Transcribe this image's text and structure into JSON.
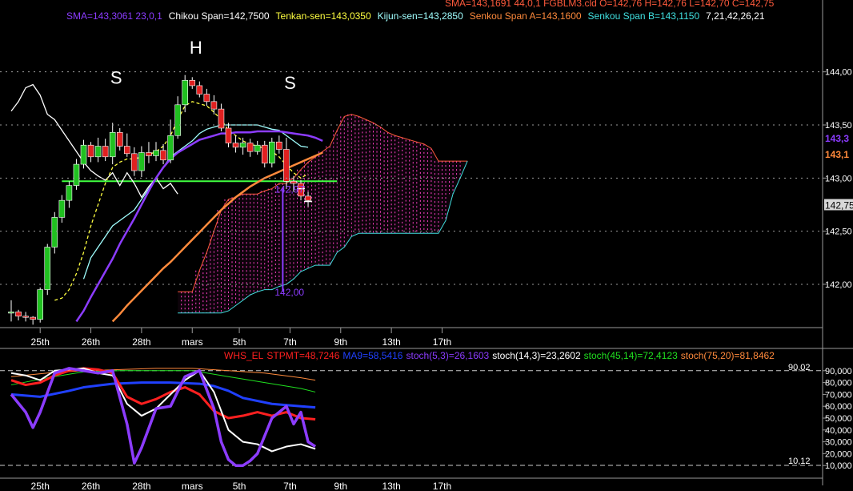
{
  "header": {
    "top_line": "SMA=143,1691  44,0,1      FGBLM3.cld O=142,76 H=142,76 L=142,70 C=142,75",
    "legend": [
      {
        "text": "SMA=143,3061  23,0,1",
        "color": "#8c3cff"
      },
      {
        "text": "Chikou Span=142,7500",
        "color": "#ffffff"
      },
      {
        "text": "Tenkan-sen=143,0350",
        "color": "#ffff40"
      },
      {
        "text": "Kijun-sen=143,2850",
        "color": "#a0ffff"
      },
      {
        "text": "Senkou Span A=143,1600",
        "color": "#ff8a3c"
      },
      {
        "text": "Senkou Span B=143,1150",
        "color": "#40e0e0"
      },
      {
        "text": "7,21,42,26,21",
        "color": "#ffffff"
      }
    ]
  },
  "pattern_labels": [
    {
      "text": "S",
      "bar": 14.5,
      "price": 143.89
    },
    {
      "text": "H",
      "bar": 25.5,
      "price": 144.17
    },
    {
      "text": "S",
      "bar": 38.5,
      "price": 143.84
    }
  ],
  "price_axis": {
    "ticks": [
      "144,00",
      "143,50",
      "143,00",
      "142,50",
      "142,00"
    ],
    "tick_values": [
      144.0,
      143.5,
      143.0,
      142.5,
      142.0
    ],
    "tags": [
      {
        "text": "143,3",
        "value": 143.38,
        "color": "#8c3cff"
      },
      {
        "text": "143,1",
        "value": 143.23,
        "color": "#ff8a3c"
      },
      {
        "text": "142,75",
        "value": 142.75,
        "color": "#000000",
        "bg": "#d8d8d8"
      }
    ]
  },
  "annotations": [
    {
      "text": "142,97",
      "bar": 37.5,
      "price": 142.9,
      "color": "#8c3cff"
    },
    {
      "text": "142,00",
      "bar": 37.5,
      "price": 141.93,
      "color": "#8c3cff"
    }
  ],
  "x_axis": {
    "labels": [
      {
        "text": "25th",
        "bar": 4
      },
      {
        "text": "26th",
        "bar": 11
      },
      {
        "text": "28th",
        "bar": 18
      },
      {
        "text": "mars",
        "bar": 25
      },
      {
        "text": "5th",
        "bar": 31.5
      },
      {
        "text": "7th",
        "bar": 38.5
      },
      {
        "text": "9th",
        "bar": 45.5
      },
      {
        "text": "13th",
        "bar": 52.5
      },
      {
        "text": "17th",
        "bar": 59.5
      }
    ]
  },
  "indicator": {
    "legend": [
      {
        "text": "WHS_EL",
        "color": "#ff2020"
      },
      {
        "text": "STPMT=48,7246",
        "color": "#ff2020"
      },
      {
        "text": "MA9=58,5416",
        "color": "#2040ff"
      },
      {
        "text": "stoch(5,3)=26,1603",
        "color": "#8c3cff"
      },
      {
        "text": "stoch(14,3)=23,2602",
        "color": "#ffffff"
      },
      {
        "text": "stoch(45,14)=72,4123",
        "color": "#20e020"
      },
      {
        "text": "stoch(75,20)=81,8462",
        "color": "#ff8a3c"
      }
    ],
    "ticks": [
      "90,000",
      "80,000",
      "70,000",
      "60,000",
      "50,000",
      "40,000",
      "30,000",
      "20,000",
      "10,000"
    ],
    "tick_values": [
      90,
      80,
      70,
      60,
      50,
      40,
      30,
      20,
      10
    ],
    "level_high": "90,02",
    "level_low": "10,12"
  },
  "chart_data": {
    "type": "line",
    "title": "FGBLM3.cld",
    "ylim": [
      141.6,
      144.45
    ],
    "candles": {
      "open": [
        141.73,
        141.74,
        141.7,
        141.69,
        141.67,
        141.95,
        142.35,
        142.63,
        142.79,
        142.93,
        143.13,
        143.31,
        143.2,
        143.3,
        143.2,
        143.43,
        143.3,
        143.23,
        143.07,
        143.24,
        143.21,
        143.26,
        143.17,
        143.4,
        143.69,
        143.92,
        143.87,
        143.79,
        143.72,
        143.65,
        143.47,
        143.33,
        143.29,
        143.33,
        143.25,
        143.31,
        143.14,
        143.34,
        143.27,
        142.97,
        142.95,
        142.83
      ],
      "close": [
        141.74,
        141.7,
        141.69,
        141.67,
        141.95,
        142.35,
        142.63,
        142.79,
        142.93,
        143.13,
        143.31,
        143.2,
        143.3,
        143.2,
        143.43,
        143.3,
        143.23,
        143.07,
        143.24,
        143.21,
        143.26,
        143.17,
        143.4,
        143.69,
        143.92,
        143.87,
        143.79,
        143.72,
        143.65,
        143.47,
        143.33,
        143.29,
        143.33,
        143.25,
        143.31,
        143.14,
        143.34,
        143.27,
        142.97,
        142.95,
        142.83,
        142.79
      ],
      "high": [
        141.85,
        141.76,
        141.74,
        141.7,
        141.97,
        142.38,
        142.68,
        142.84,
        142.97,
        143.18,
        143.36,
        143.34,
        143.38,
        143.37,
        143.52,
        143.47,
        143.42,
        143.29,
        143.3,
        143.34,
        143.34,
        143.32,
        143.55,
        143.77,
        143.97,
        143.95,
        143.91,
        143.84,
        143.78,
        143.7,
        143.52,
        143.4,
        143.38,
        143.37,
        143.35,
        143.35,
        143.38,
        143.4,
        143.38,
        143.02,
        142.98,
        142.87
      ],
      "low": [
        141.65,
        141.66,
        141.65,
        141.62,
        141.64,
        141.9,
        142.29,
        142.58,
        142.72,
        142.89,
        143.09,
        143.15,
        143.15,
        143.16,
        143.13,
        143.26,
        143.2,
        143.02,
        143.01,
        143.14,
        143.16,
        143.13,
        143.14,
        143.37,
        143.62,
        143.84,
        143.76,
        143.68,
        143.6,
        143.44,
        143.29,
        143.24,
        143.22,
        143.2,
        143.22,
        143.1,
        143.1,
        143.23,
        142.9,
        142.87,
        142.79,
        142.73
      ]
    },
    "series": [
      {
        "name": "Chikou Span",
        "color": "#ffffff",
        "x": [
          0,
          1,
          2,
          3,
          4,
          5,
          6,
          7,
          8,
          9,
          10,
          11,
          12,
          13,
          14,
          15,
          16,
          17,
          18,
          19,
          20,
          21,
          22,
          23
        ],
        "values": [
          143.63,
          143.72,
          143.85,
          143.88,
          143.78,
          143.6,
          143.55,
          143.45,
          143.35,
          143.25,
          143.15,
          143.07,
          143.02,
          142.98,
          143.05,
          142.93,
          143.05,
          142.95,
          142.82,
          142.92,
          143.0,
          142.9,
          142.95,
          142.85
        ]
      },
      {
        "name": "Tenkan-sen",
        "color": "#ffff40",
        "x": [
          6,
          7,
          8,
          9,
          10,
          11,
          12,
          13,
          14,
          15,
          16,
          17,
          18,
          19,
          20,
          21,
          22,
          23,
          24,
          25,
          26,
          27,
          28,
          29,
          30,
          31,
          32,
          33,
          34,
          35,
          36,
          37,
          38,
          39,
          40,
          41
        ],
        "values": [
          141.85,
          141.87,
          141.95,
          142.1,
          142.3,
          142.55,
          142.75,
          142.95,
          143.1,
          143.15,
          143.18,
          143.18,
          143.2,
          143.22,
          143.25,
          143.3,
          143.4,
          143.55,
          143.68,
          143.72,
          143.7,
          143.68,
          143.62,
          143.55,
          143.45,
          143.4,
          143.35,
          143.32,
          143.3,
          143.28,
          143.25,
          143.2,
          143.12,
          143.05,
          143.0,
          143.04
        ]
      },
      {
        "name": "Kijun-sen",
        "color": "#a0ffff",
        "x": [
          10,
          11,
          12,
          13,
          14,
          15,
          16,
          17,
          18,
          19,
          20,
          21,
          22,
          23,
          24,
          25,
          26,
          27,
          28,
          29,
          30,
          31,
          32,
          33,
          34,
          35,
          36,
          37,
          38,
          39,
          40,
          41
        ],
        "values": [
          142.05,
          142.25,
          142.35,
          142.45,
          142.55,
          142.6,
          142.65,
          142.7,
          142.8,
          142.9,
          143.0,
          143.1,
          143.2,
          143.25,
          143.3,
          143.35,
          143.42,
          143.46,
          143.48,
          143.5,
          143.5,
          143.5,
          143.5,
          143.5,
          143.5,
          143.48,
          143.46,
          143.45,
          143.4,
          143.35,
          143.3,
          143.29
        ]
      },
      {
        "name": "SMA 23",
        "color": "#8c3cff",
        "x": [
          9,
          10,
          11,
          12,
          13,
          14,
          15,
          16,
          17,
          18,
          19,
          20,
          21,
          22,
          23,
          24,
          25,
          26,
          27,
          28,
          29,
          30,
          31,
          32,
          33,
          34,
          35,
          36,
          37,
          38,
          39,
          40,
          41,
          42,
          43
        ],
        "values": [
          141.65,
          141.75,
          141.88,
          142.0,
          142.12,
          142.24,
          142.38,
          142.5,
          142.62,
          142.75,
          142.88,
          143.0,
          143.1,
          143.18,
          143.24,
          143.28,
          143.32,
          143.36,
          143.38,
          143.4,
          143.42,
          143.42,
          143.43,
          143.43,
          143.43,
          143.44,
          143.44,
          143.44,
          143.44,
          143.43,
          143.42,
          143.41,
          143.4,
          143.38,
          143.35
        ]
      },
      {
        "name": "SMA 44",
        "color": "#ff8a3c",
        "x": [
          14,
          15,
          16,
          17,
          18,
          19,
          20,
          21,
          22,
          23,
          24,
          25,
          26,
          27,
          28,
          29,
          30,
          31,
          32,
          33,
          34,
          35,
          36,
          37,
          38,
          39,
          40,
          41,
          42,
          43
        ],
        "values": [
          141.65,
          141.72,
          141.8,
          141.87,
          141.94,
          142.01,
          142.08,
          142.15,
          142.21,
          142.28,
          142.35,
          142.42,
          142.49,
          142.56,
          142.63,
          142.7,
          142.76,
          142.82,
          142.87,
          142.92,
          142.96,
          143.0,
          143.03,
          143.06,
          143.09,
          143.12,
          143.15,
          143.18,
          143.21,
          143.24
        ]
      }
    ],
    "cloud": {
      "x": [
        23,
        24,
        25,
        26,
        27,
        28,
        29,
        30,
        31,
        32,
        33,
        34,
        35,
        36,
        37,
        38,
        39,
        40,
        41,
        42,
        43,
        44,
        45,
        46,
        47,
        48,
        49,
        50,
        51,
        52,
        53,
        54,
        55,
        56,
        57,
        58,
        59,
        60,
        61,
        62,
        63
      ],
      "span_a": [
        141.93,
        141.93,
        141.93,
        142.13,
        142.3,
        142.5,
        142.7,
        142.8,
        142.82,
        142.85,
        142.85,
        142.85,
        142.88,
        142.9,
        142.95,
        142.95,
        143.0,
        143.08,
        143.15,
        143.2,
        143.25,
        143.3,
        143.45,
        143.58,
        143.6,
        143.58,
        143.55,
        143.52,
        143.48,
        143.43,
        143.4,
        143.38,
        143.36,
        143.34,
        143.32,
        143.28,
        143.16,
        143.16,
        143.16,
        143.16,
        143.16
      ],
      "span_b": [
        141.73,
        141.73,
        141.73,
        141.73,
        141.73,
        141.73,
        141.73,
        141.75,
        141.8,
        141.85,
        141.9,
        141.93,
        141.95,
        141.95,
        141.98,
        142.0,
        142.05,
        142.12,
        142.15,
        142.18,
        142.18,
        142.18,
        142.3,
        142.35,
        142.45,
        142.48,
        142.48,
        142.48,
        142.48,
        142.48,
        142.48,
        142.48,
        142.48,
        142.48,
        142.48,
        142.48,
        142.48,
        142.6,
        142.85,
        143.0,
        143.16
      ]
    },
    "horizontal_line": {
      "value": 142.97,
      "color": "#40ff40",
      "from_bar": 7,
      "to_bar": 45
    },
    "vertical_marker": {
      "bar": 37.5,
      "from": 141.93,
      "to": 142.9,
      "color": "#8c3cff"
    },
    "forecast_ticks": [
      {
        "bar": 40,
        "value": 142.9
      },
      {
        "bar": 41,
        "value": 142.78
      }
    ],
    "oscillators": {
      "ylim": [
        0,
        100
      ],
      "series": [
        {
          "name": "stoch(75,20)",
          "color": "#ff8a3c",
          "x": [
            0,
            5,
            10,
            15,
            20,
            25,
            30,
            35,
            40,
            42
          ],
          "values": [
            85,
            88,
            90,
            91,
            92,
            92,
            90,
            88,
            84,
            82
          ]
        },
        {
          "name": "stoch(45,14)",
          "color": "#20e020",
          "x": [
            0,
            5,
            10,
            15,
            20,
            25,
            30,
            35,
            40,
            42
          ],
          "values": [
            78,
            84,
            89,
            90,
            90,
            90,
            85,
            80,
            75,
            72
          ]
        },
        {
          "name": "MA9",
          "color": "#2040ff",
          "x": [
            0,
            4,
            8,
            10,
            14,
            18,
            22,
            26,
            28,
            30,
            32,
            36,
            40,
            42
          ],
          "values": [
            70,
            68,
            73,
            76,
            79,
            80,
            80,
            79,
            77,
            73,
            67,
            62,
            60,
            59
          ]
        },
        {
          "name": "STPMT",
          "color": "#ff2020",
          "x": [
            0,
            2,
            4,
            6,
            8,
            10,
            12,
            14,
            16,
            18,
            20,
            22,
            24,
            26,
            28,
            30,
            32,
            34,
            36,
            38,
            40,
            42
          ],
          "values": [
            82,
            78,
            80,
            86,
            90,
            92,
            91,
            88,
            68,
            62,
            66,
            72,
            76,
            70,
            56,
            50,
            52,
            55,
            52,
            55,
            50,
            49
          ]
        },
        {
          "name": "stoch(14,3)",
          "color": "#ffffff",
          "x": [
            0,
            2,
            4,
            6,
            8,
            10,
            12,
            14,
            16,
            18,
            20,
            22,
            24,
            26,
            28,
            30,
            32,
            34,
            36,
            38,
            40,
            42
          ],
          "values": [
            88,
            86,
            82,
            90,
            91,
            92,
            88,
            86,
            62,
            52,
            58,
            70,
            82,
            90,
            72,
            40,
            30,
            28,
            22,
            26,
            28,
            24
          ]
        },
        {
          "name": "stoch(5,3)",
          "color": "#8c3cff",
          "x": [
            0,
            2,
            3,
            4,
            6,
            8,
            10,
            12,
            14,
            16,
            17,
            18,
            20,
            22,
            24,
            26,
            28,
            29,
            30,
            31,
            32,
            33,
            34,
            36,
            38,
            39,
            40,
            41,
            42
          ],
          "values": [
            70,
            55,
            42,
            55,
            88,
            92,
            90,
            88,
            90,
            45,
            12,
            25,
            58,
            60,
            85,
            90,
            58,
            30,
            15,
            10,
            10,
            14,
            20,
            50,
            60,
            45,
            55,
            30,
            26
          ]
        }
      ]
    }
  }
}
